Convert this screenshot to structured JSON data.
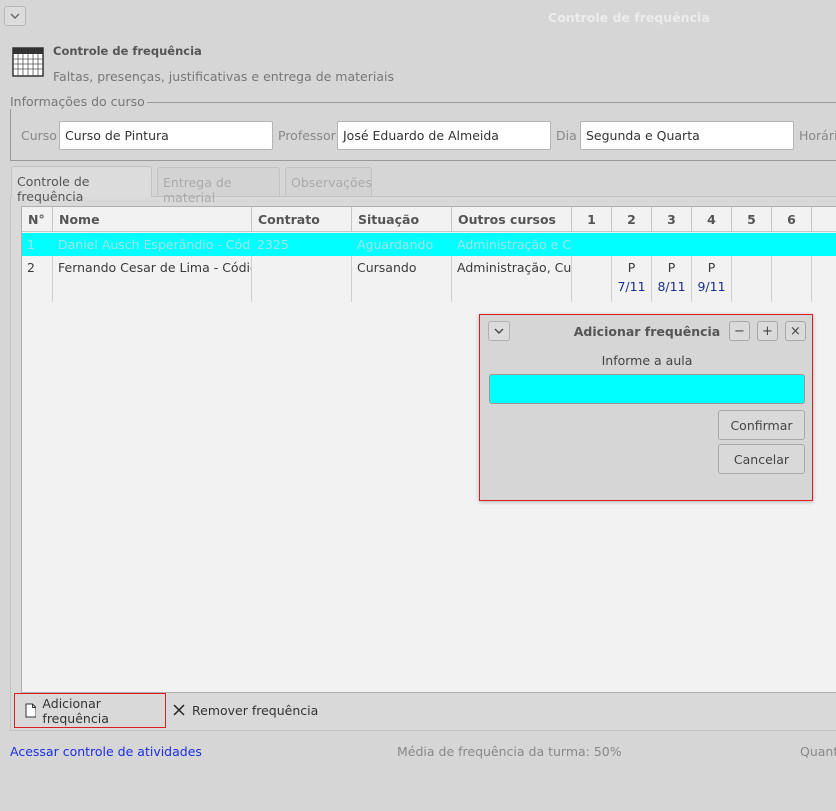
{
  "window": {
    "title": "Controle de frequência",
    "menu_icon": "chevron-down-icon"
  },
  "header": {
    "title": "Controle de frequência",
    "subtitle": "Faltas, presenças, justificativas e entrega de materiais",
    "icon": "calendar-icon"
  },
  "course_info": {
    "legend": "Informações do curso",
    "course_label": "Curso",
    "course_value": "Curso de Pintura",
    "teacher_label": "Professor",
    "teacher_value": "José Eduardo de Almeida",
    "day_label": "Dia",
    "day_value": "Segunda e Quarta",
    "time_label": "Horári"
  },
  "tabs": [
    {
      "label": "Controle de frequência",
      "active": true
    },
    {
      "label": "Entrega de material",
      "active": false
    },
    {
      "label": "Observações",
      "active": false
    }
  ],
  "table": {
    "headers": [
      "N°",
      "Nome",
      "Contrato",
      "Situação",
      "Outros cursos",
      "1",
      "2",
      "3",
      "4",
      "5",
      "6"
    ],
    "rows": [
      {
        "n": "1",
        "nome": "Daniel Ausch Esperândio - Código: ",
        "contrato": "2325",
        "situacao": "Aguardando",
        "outros": "Administração e Cur",
        "aulas": [
          "",
          "",
          "",
          "",
          "",
          ""
        ],
        "datas": [
          "",
          "",
          "",
          "",
          "",
          ""
        ],
        "selected": true,
        "highlight_color": "#00ffff"
      },
      {
        "n": "2",
        "nome": "Fernando Cesar de Lima - Código: '",
        "contrato": "",
        "situacao": "Cursando",
        "outros": "Administração, Curs",
        "aulas": [
          "",
          "P",
          "P",
          "P",
          "",
          ""
        ],
        "datas": [
          "",
          "7/11",
          "8/11",
          "9/11",
          "",
          ""
        ],
        "selected": false
      }
    ]
  },
  "toolbar": {
    "add_label": "Adicionar frequência",
    "add_icon": "new-document-icon",
    "remove_label": "Remover frequência",
    "remove_icon": "close-icon"
  },
  "footer": {
    "link": "Acessar controle de atividades",
    "average": "Média de frequência da turma: 50%",
    "quant": "Quant"
  },
  "dialog": {
    "title": "Adicionar frequência",
    "prompt": "Informe a aula",
    "input_value": "",
    "confirm_label": "Confirmar",
    "cancel_label": "Cancelar",
    "minimize_glyph": "−",
    "maximize_glyph": "+",
    "close_glyph": "×",
    "input_color": "#00ffff"
  },
  "colors": {
    "accent_highlight": "#00ffff",
    "focus_border": "#d62020",
    "link": "#1a2fe0",
    "date_text": "#1a2f8f"
  }
}
